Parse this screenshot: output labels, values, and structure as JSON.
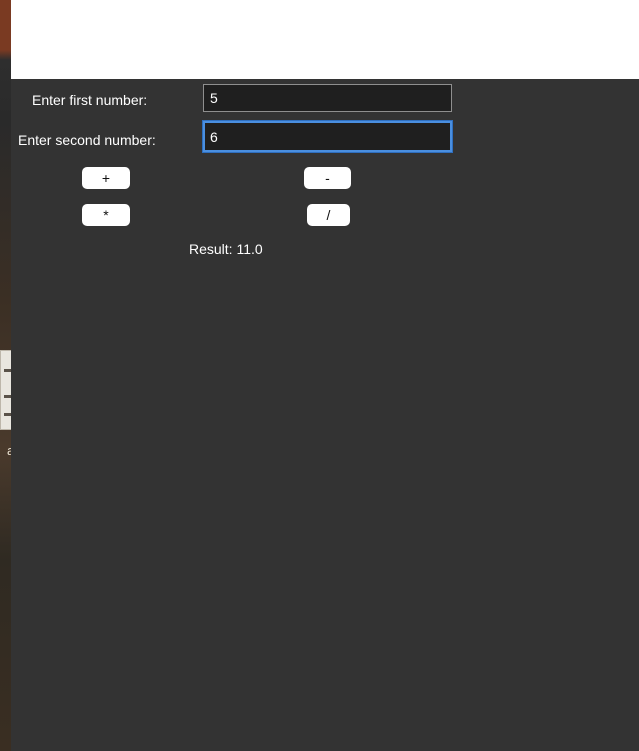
{
  "form": {
    "first_label": "Enter first number:",
    "first_value": "5",
    "second_label": "Enter second number:",
    "second_value": "6"
  },
  "buttons": {
    "add": "+",
    "subtract": "-",
    "multiply": "*",
    "divide": "/"
  },
  "result": {
    "text": "Result: 11.0"
  },
  "desktop": {
    "partial_letter": "a"
  },
  "colors": {
    "window_bg": "#333333",
    "input_bg": "#1f1f1f",
    "focus_ring": "#4a8fe0",
    "button_bg": "#ffffff",
    "text": "#ffffff"
  }
}
